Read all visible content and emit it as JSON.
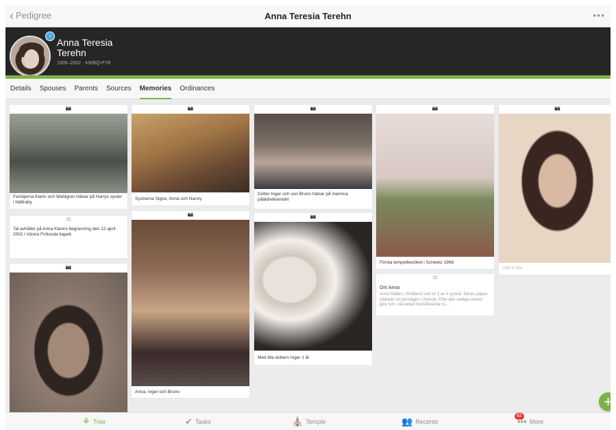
{
  "nav": {
    "back_label": "Pedigree",
    "title": "Anna Teresia Terehn",
    "more_label": "•••"
  },
  "person": {
    "name": "Anna Teresia Terehn",
    "meta": "1906–2002 · KWBQ-P7R"
  },
  "tabs": [
    {
      "label": "Details"
    },
    {
      "label": "Spouses"
    },
    {
      "label": "Parents"
    },
    {
      "label": "Sources"
    },
    {
      "label": "Memories",
      "active": true
    },
    {
      "label": "Ordinances"
    }
  ],
  "memories": {
    "m1_caption": "Familjerna Klarin och Wahlgren hälsar på Harrys syster i Nättraby",
    "m2_text": "Tal avhållet på Anna Klarins begravning den 12 april 2002 i Västra Frölunda kapell.",
    "m4_caption": "Systrarna Signe, Anna och Nanny",
    "m5_caption": "Anna, Inger och Bruno",
    "m6_caption": "Dotter Inger och son Bruno hälsar på mamma påäldreboendet",
    "m7_caption": "Med lilla dottern Inger 1 år",
    "m8_caption": "Första tempelbesöket i Schweiz 1968",
    "m9_title": "Om Anna",
    "m9_body": "Anna föddes i Småland som nr 3 av 4 systrar. Deras pappa jobbade vid järnvägen i Alvesta. Efter den vanliga skolan gick hon i så kallad hushållsskola oc...",
    "m10_placeholder": "Add a title."
  },
  "tabbar": {
    "tree": "Tree",
    "tasks": "Tasks",
    "temple": "Temple",
    "recents": "Recents",
    "more": "More",
    "more_badge": "62"
  },
  "colors": {
    "accent": "#7cb342",
    "header_bg": "#262626",
    "badge": "#e53935"
  }
}
